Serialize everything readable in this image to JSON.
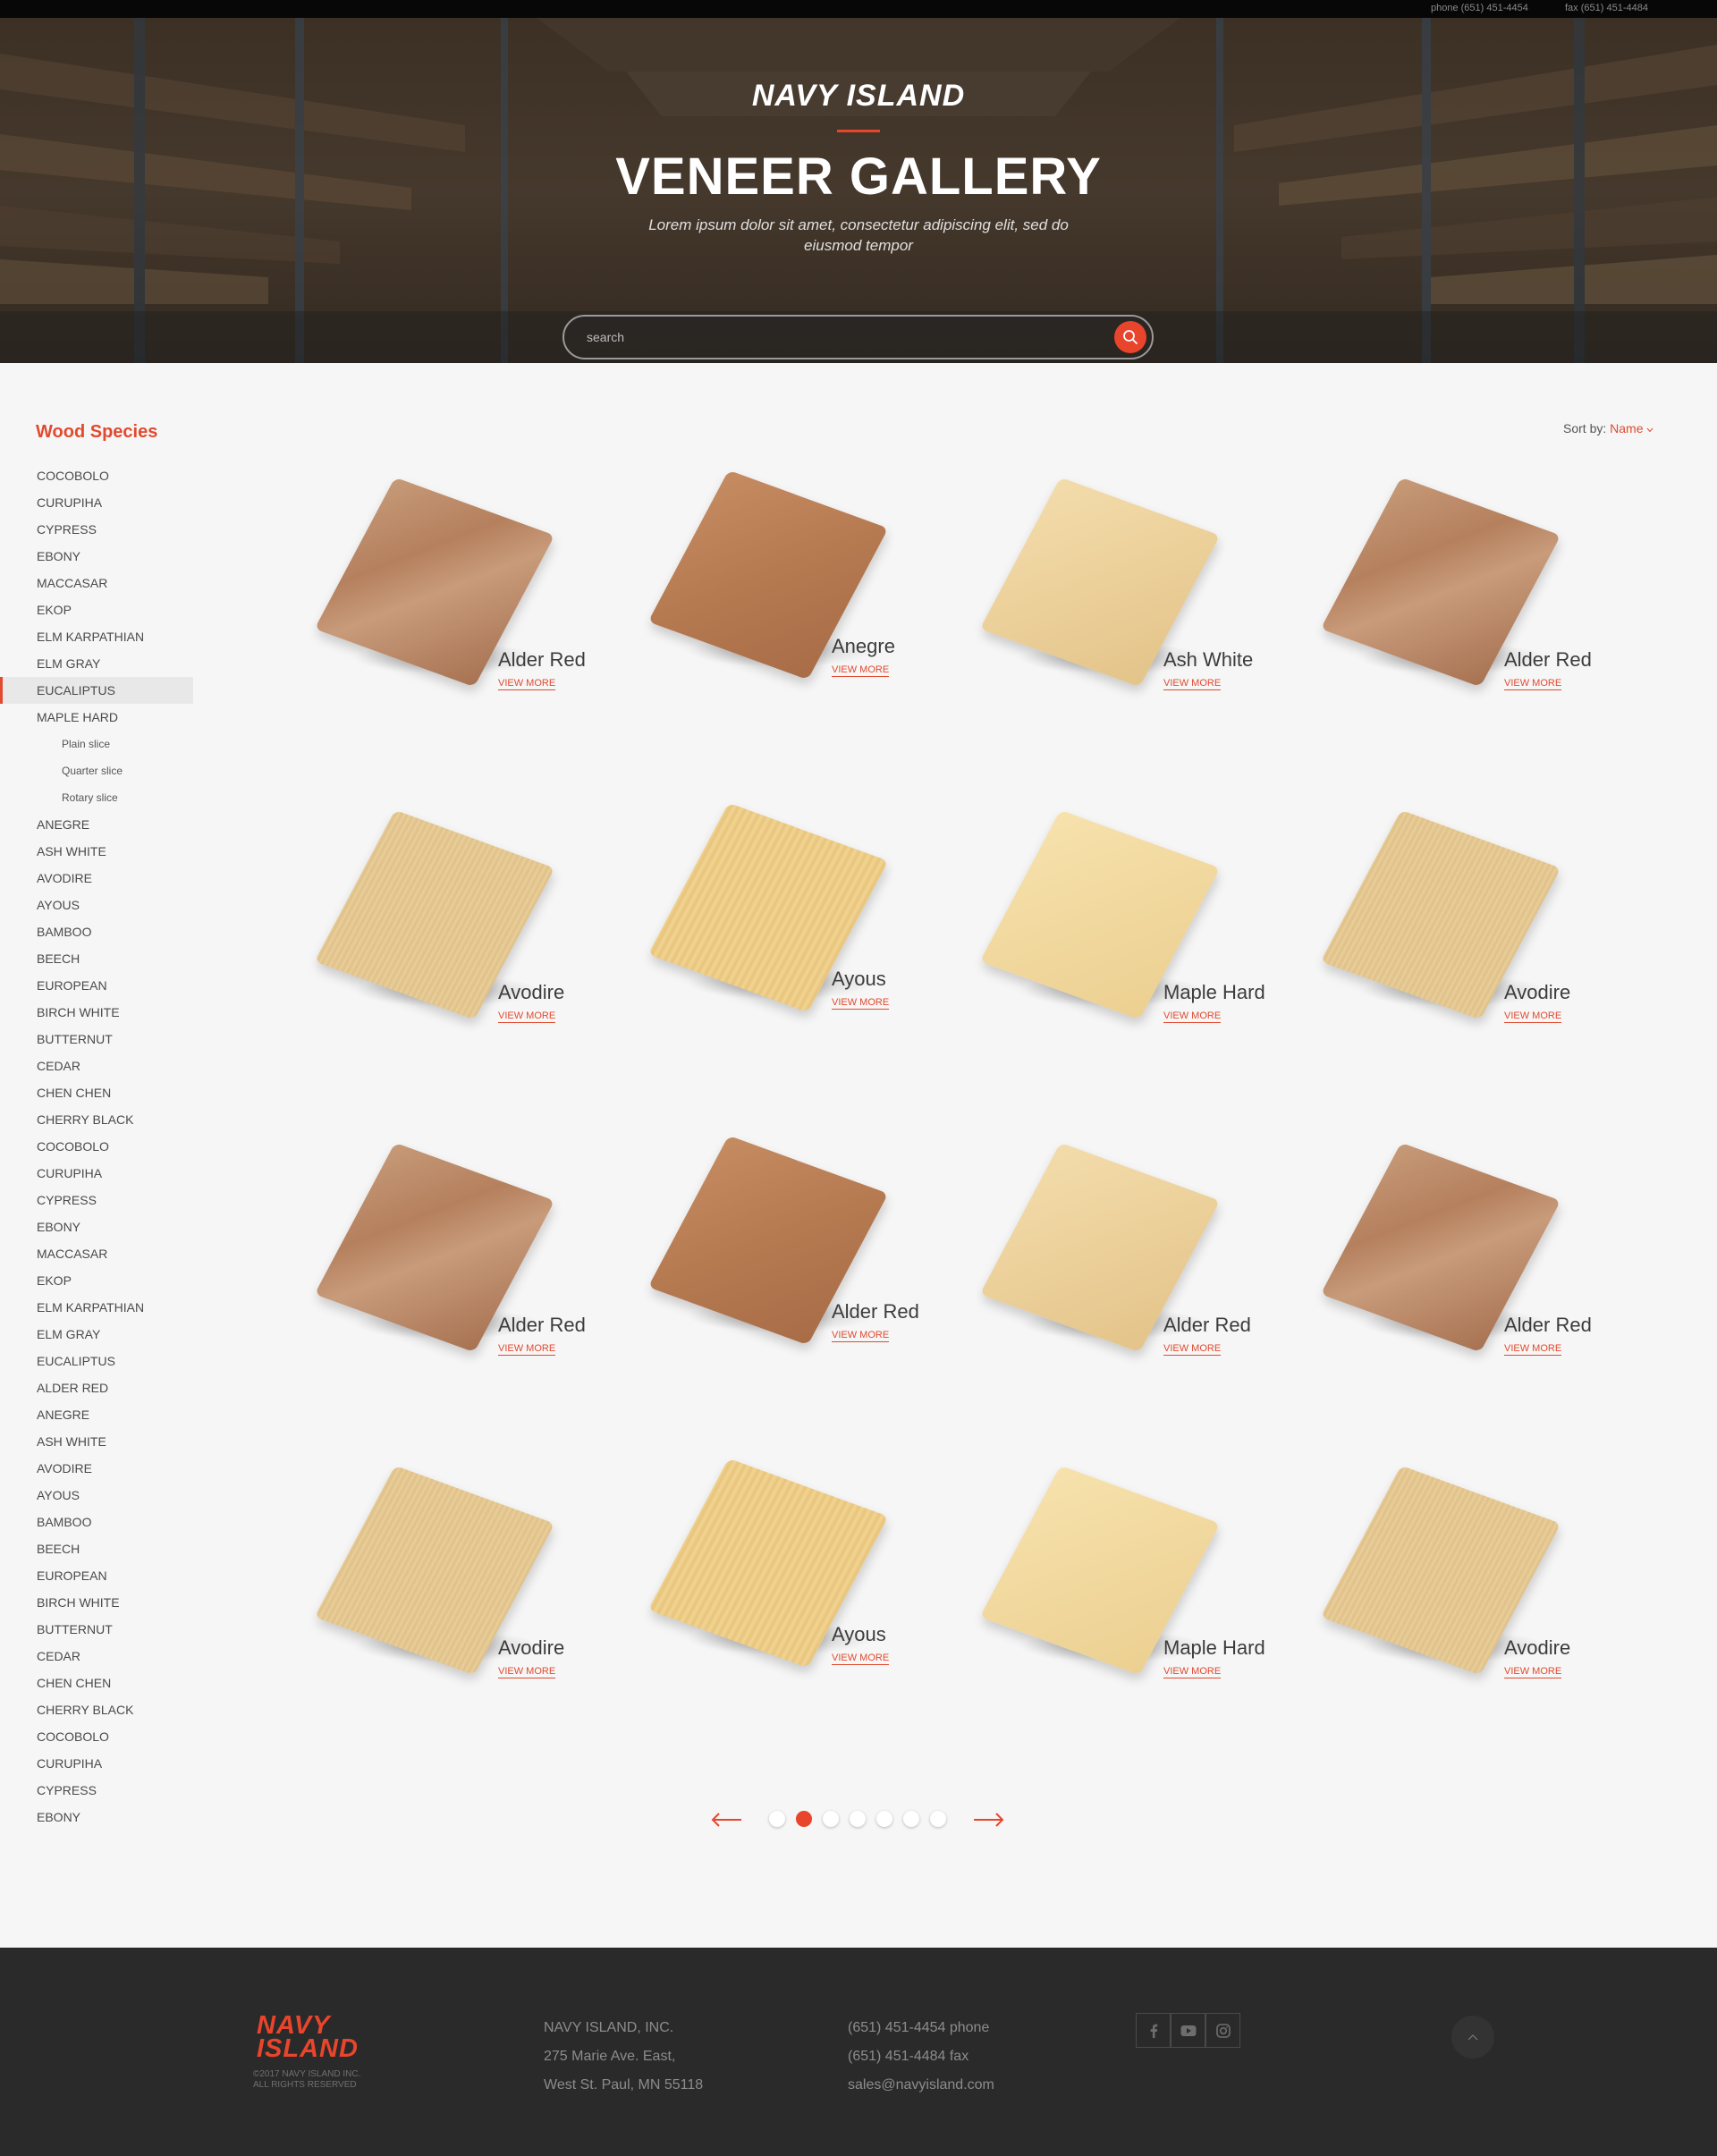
{
  "topbar": {
    "phone": "phone (651) 451-4454",
    "fax": "fax (651) 451-4484"
  },
  "hero": {
    "brand": "NAVY ISLAND",
    "title": "VENEER GALLERY",
    "subtitle": "Lorem ipsum dolor sit amet, consectetur adipiscing elit, sed do eiusmod tempor",
    "search_placeholder": "search"
  },
  "sidebar": {
    "title": "Wood Species",
    "items": [
      {
        "label": "COCOBOLO"
      },
      {
        "label": "CURUPIHA"
      },
      {
        "label": "CYPRESS"
      },
      {
        "label": "EBONY"
      },
      {
        "label": "MACCASAR"
      },
      {
        "label": "EKOP"
      },
      {
        "label": "ELM KARPATHIAN"
      },
      {
        "label": "ELM GRAY"
      },
      {
        "label": "EUCALIPTUS",
        "active": true
      },
      {
        "label": "MAPLE HARD"
      },
      {
        "label": "Plain slice",
        "sub": true
      },
      {
        "label": "Quarter slice",
        "sub": true
      },
      {
        "label": "Rotary slice",
        "sub": true
      },
      {
        "label": "ANEGRE"
      },
      {
        "label": "ASH WHITE"
      },
      {
        "label": "AVODIRE"
      },
      {
        "label": "AYOUS"
      },
      {
        "label": "BAMBOO"
      },
      {
        "label": "BEECH"
      },
      {
        "label": "EUROPEAN"
      },
      {
        "label": "BIRCH WHITE"
      },
      {
        "label": "BUTTERNUT"
      },
      {
        "label": "CEDAR"
      },
      {
        "label": "CHEN CHEN"
      },
      {
        "label": "CHERRY BLACK"
      },
      {
        "label": "COCOBOLO"
      },
      {
        "label": "CURUPIHA"
      },
      {
        "label": "CYPRESS"
      },
      {
        "label": "EBONY"
      },
      {
        "label": "MACCASAR"
      },
      {
        "label": "EKOP"
      },
      {
        "label": "ELM KARPATHIAN"
      },
      {
        "label": "ELM GRAY"
      },
      {
        "label": "EUCALIPTUS"
      },
      {
        "label": "ALDER RED"
      },
      {
        "label": "ANEGRE"
      },
      {
        "label": "ASH WHITE"
      },
      {
        "label": "AVODIRE"
      },
      {
        "label": "AYOUS"
      },
      {
        "label": "BAMBOO"
      },
      {
        "label": "BEECH"
      },
      {
        "label": "EUROPEAN"
      },
      {
        "label": "BIRCH WHITE"
      },
      {
        "label": "BUTTERNUT"
      },
      {
        "label": "CEDAR"
      },
      {
        "label": "CHEN CHEN"
      },
      {
        "label": "CHERRY BLACK"
      },
      {
        "label": "COCOBOLO"
      },
      {
        "label": "CURUPIHA"
      },
      {
        "label": "CYPRESS"
      },
      {
        "label": "EBONY"
      }
    ]
  },
  "sort": {
    "label": "Sort by:",
    "value": "Name"
  },
  "gallery": {
    "more_label": "VIEW MORE",
    "items": [
      {
        "name": "Alder Red",
        "wood": "alder"
      },
      {
        "name": "Anegre",
        "wood": "anegre"
      },
      {
        "name": "Ash White",
        "wood": "ash"
      },
      {
        "name": "Alder Red",
        "wood": "alder"
      },
      {
        "name": "Avodire",
        "wood": "avodire"
      },
      {
        "name": "Ayous",
        "wood": "ayous"
      },
      {
        "name": "Maple Hard",
        "wood": "maple"
      },
      {
        "name": "Avodire",
        "wood": "avodire"
      },
      {
        "name": "Alder Red",
        "wood": "alder"
      },
      {
        "name": "Alder Red",
        "wood": "anegre"
      },
      {
        "name": "Alder Red",
        "wood": "ash"
      },
      {
        "name": "Alder Red",
        "wood": "alder"
      },
      {
        "name": "Avodire",
        "wood": "avodire"
      },
      {
        "name": "Ayous",
        "wood": "ayous"
      },
      {
        "name": "Maple Hard",
        "wood": "maple"
      },
      {
        "name": "Avodire",
        "wood": "avodire"
      }
    ]
  },
  "pagination": {
    "page_count": 7,
    "current_page": 2
  },
  "footer": {
    "logo_line1": "NAVY",
    "logo_line2": "ISLAND",
    "copyright_line1": "©2017 NAVY ISLAND INC.",
    "copyright_line2": "ALL RIGHTS RESERVED",
    "address": [
      "NAVY ISLAND, INC.",
      "275 Marie Ave. East,",
      "West St. Paul, MN 55118"
    ],
    "contact": [
      "(651) 451-4454 phone",
      "(651) 451-4484 fax",
      "sales@navyisland.com"
    ],
    "social_icons": [
      "facebook-icon",
      "youtube-icon",
      "instagram-icon"
    ]
  },
  "colors": {
    "accent": "#e8452c",
    "footer_bg": "#2a2a2a",
    "page_bg": "#f6f6f6"
  }
}
